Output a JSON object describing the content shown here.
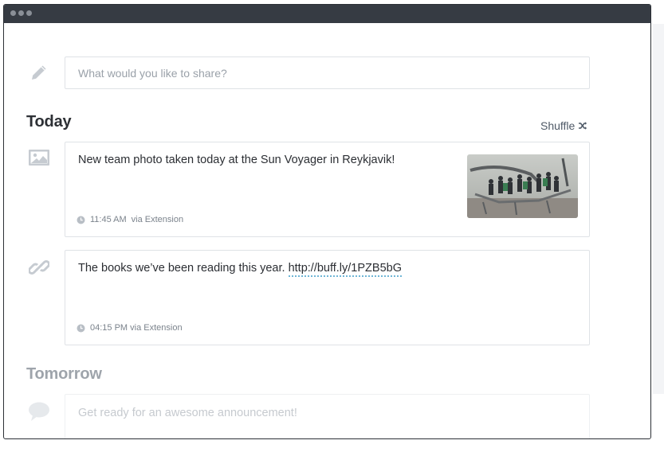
{
  "compose": {
    "placeholder": "What would you like to share?"
  },
  "sections": {
    "today": {
      "title": "Today",
      "shuffle_label": "Shuffle"
    },
    "tomorrow": {
      "title": "Tomorrow"
    }
  },
  "posts": [
    {
      "text": "New team photo taken today at the Sun Voyager in Reykjavik!",
      "time": "11:45 AM",
      "via": "via Extension",
      "type_icon": "image-icon",
      "has_thumbnail": true
    },
    {
      "text": "The books we’ve been reading this year. ",
      "link": "http://buff.ly/1PZB5bG",
      "meta": "04:15 PM via Extension",
      "type_icon": "link-icon"
    },
    {
      "text": "Get ready for an awesome announcement!",
      "type_icon": "speech-bubble-icon"
    }
  ],
  "colors": {
    "titlebar": "#363b43",
    "link_underline": "#6fb6d6",
    "icon_gray": "#c6cbd1",
    "text_dark": "#2d3035"
  }
}
